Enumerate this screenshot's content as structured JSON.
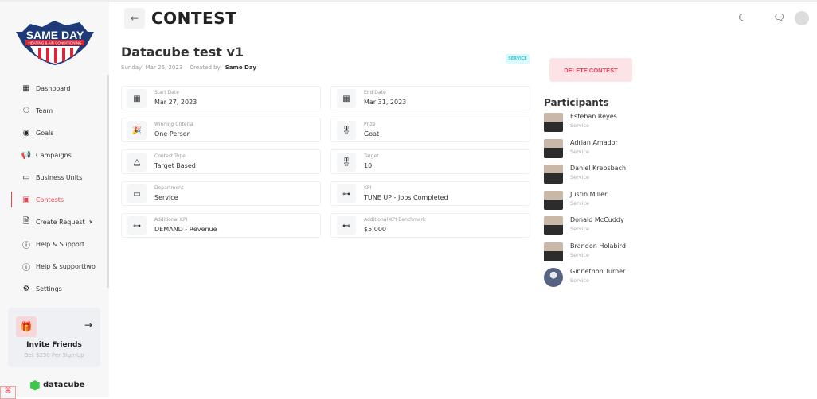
{
  "sidebar": {
    "logo_text": "SAME DAY",
    "logo_sub": "HEATING & AIR CONDITIONING",
    "items": [
      {
        "label": "Dashboard",
        "icon": "dashboard-icon",
        "glyph": "▦"
      },
      {
        "label": "Team",
        "icon": "team-icon",
        "glyph": "⚇"
      },
      {
        "label": "Goals",
        "icon": "goals-icon",
        "glyph": "◉"
      },
      {
        "label": "Campaigns",
        "icon": "megaphone-icon",
        "glyph": "📢"
      },
      {
        "label": "Business Units",
        "icon": "briefcase-icon",
        "glyph": "▭"
      },
      {
        "label": "Contests",
        "icon": "contests-icon",
        "glyph": "▣",
        "active": true
      },
      {
        "label": "Create Request",
        "icon": "document-edit-icon",
        "glyph": "🗎",
        "chevron": true
      },
      {
        "label": "Help & Support",
        "icon": "info-icon",
        "glyph": "ⓘ"
      },
      {
        "label": "Help & supporttwo",
        "icon": "info-icon",
        "glyph": "ⓘ"
      },
      {
        "label": "Settings",
        "icon": "gear-icon",
        "glyph": "⚙"
      }
    ],
    "invite": {
      "title": "Invite Friends",
      "subtitle": "Get $250 Per Sign-Up"
    },
    "brand": "datacube"
  },
  "header": {
    "title": "CONTEST"
  },
  "contest": {
    "title": "Datacube test v1",
    "date": "Sunday, Mar 26, 2023",
    "created_by_label": "Created by",
    "created_by": "Same Day",
    "badge": "SERVICE",
    "delete_label": "DELETE CONTEST",
    "fields": [
      {
        "label": "Start Date",
        "value": "Mar 27, 2023",
        "icon": "calendar-icon",
        "glyph": "▦"
      },
      {
        "label": "End Date",
        "value": "Mar 31, 2023",
        "icon": "calendar-icon",
        "glyph": "▦"
      },
      {
        "label": "Winning Criteria",
        "value": "One Person",
        "icon": "party-popper-icon",
        "glyph": "🎉"
      },
      {
        "label": "Prize",
        "value": "Goat",
        "icon": "medal-icon",
        "glyph": "🎖"
      },
      {
        "label": "Contest Type",
        "value": "Target Based",
        "icon": "shapes-icon",
        "glyph": "⧋"
      },
      {
        "label": "Target",
        "value": "10",
        "icon": "medal-icon",
        "glyph": "🎖"
      },
      {
        "label": "Department",
        "value": "Service",
        "icon": "briefcase-icon",
        "glyph": "▭"
      },
      {
        "label": "KPI",
        "value": "TUNE UP - Jobs Completed",
        "icon": "hierarchy-icon",
        "glyph": "⊶"
      },
      {
        "label": "Additional KPI",
        "value": "DEMAND - Revenue",
        "icon": "hierarchy-icon",
        "glyph": "⊶"
      },
      {
        "label": "Additional KPI Benchmark",
        "value": "$5,000",
        "icon": "hierarchy-icon",
        "glyph": "⊷"
      }
    ]
  },
  "participants": {
    "title": "Participants",
    "list": [
      {
        "name": "Esteban Reyes",
        "role": "Service"
      },
      {
        "name": "Adrian Amador",
        "role": "Service"
      },
      {
        "name": "Daniel Krebsbach",
        "role": "Service"
      },
      {
        "name": "Justin Miller",
        "role": "Service"
      },
      {
        "name": "Donald McCuddy",
        "role": "Service"
      },
      {
        "name": "Brandon Holabird",
        "role": "Service"
      },
      {
        "name": "Ginnethon Turner",
        "role": "Service",
        "placeholder": true
      }
    ]
  }
}
